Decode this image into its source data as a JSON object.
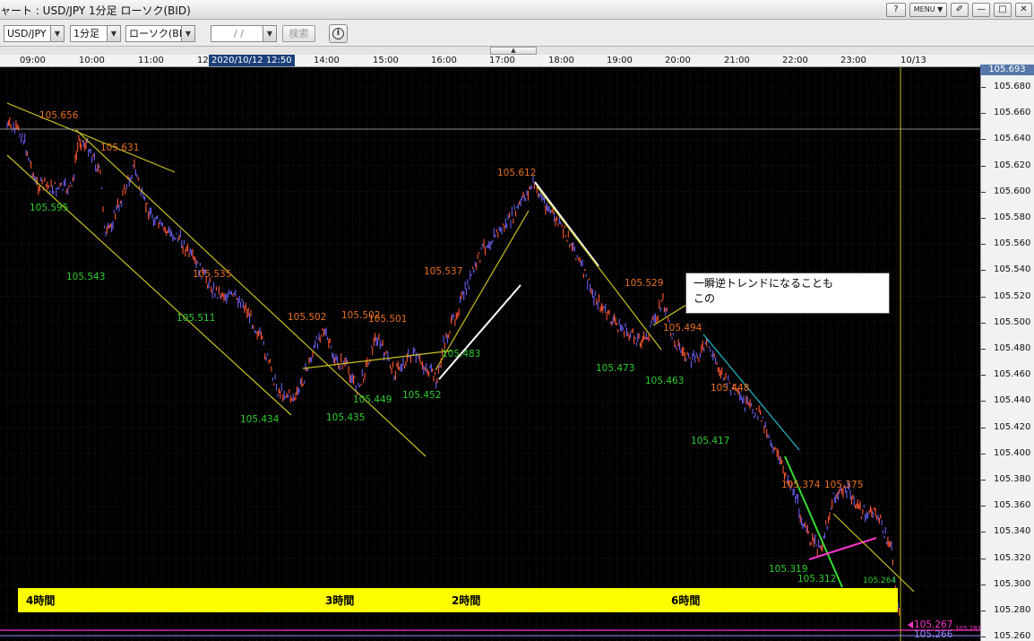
{
  "window": {
    "title": "ャート : USD/JPY 1分足 ローソク(BID)",
    "buttons": {
      "help": "?",
      "menu": "MENU ▼",
      "pin": "✐",
      "minimize": "—",
      "maximize": "□",
      "close": "✕"
    }
  },
  "toolbar": {
    "symbol": "USD/JPY",
    "timeframe": "1分足",
    "chart_type": "ローソク(BID)",
    "date_input": "/ /",
    "search_label": "検索"
  },
  "time_axis": {
    "labels": [
      "09:00",
      "10:00",
      "11:00",
      "12:",
      "14:00",
      "15:00",
      "16:00",
      "17:00",
      "18:00",
      "19:00",
      "20:00",
      "21:00",
      "22:00",
      "23:00",
      "10/13"
    ],
    "cursor_label": "2020/10/12 12:50"
  },
  "price_axis": {
    "top_value": "105.693",
    "labels": [
      "105.680",
      "105.660",
      "105.640",
      "105.620",
      "105.600",
      "105.580",
      "105.560",
      "105.540",
      "105.520",
      "105.500",
      "105.480",
      "105.460",
      "105.440",
      "105.420",
      "105.400",
      "105.380",
      "105.360",
      "105.340",
      "105.320",
      "105.300",
      "105.280",
      "105.260"
    ]
  },
  "annotations": {
    "highs": [
      "105.656",
      "105.631",
      "105.535",
      "105.502",
      "105.502",
      "105.501",
      "105.537",
      "105.612",
      "105.529",
      "105.494",
      "105.448",
      "105.374",
      "105.375"
    ],
    "lows": [
      "105.595",
      "105.543",
      "105.511",
      "105.434",
      "105.435",
      "105.449",
      "105.452",
      "105.483",
      "105.473",
      "105.463",
      "105.417",
      "105.319",
      "105.312"
    ],
    "last_prices": [
      "105.267",
      "105.266",
      "105.264",
      "105.283"
    ]
  },
  "callout": {
    "line1": "一瞬逆トレンドになることも",
    "line2": "この"
  },
  "session_banner": {
    "labels": [
      "4時間",
      "3時間",
      "2時間",
      "6時間"
    ]
  },
  "colors": {
    "background": "#000000",
    "grid": "#333333",
    "trendline": "#c8c020",
    "high_label": "#e87020",
    "low_label": "#2ecc2e",
    "banner": "#ffff00",
    "candle_up": "#ff5533",
    "candle_down": "#6a5ff0",
    "magenta": "#ff33cc",
    "cyan": "#22bbcc",
    "green": "#33dd33",
    "white": "#ffffff"
  }
}
